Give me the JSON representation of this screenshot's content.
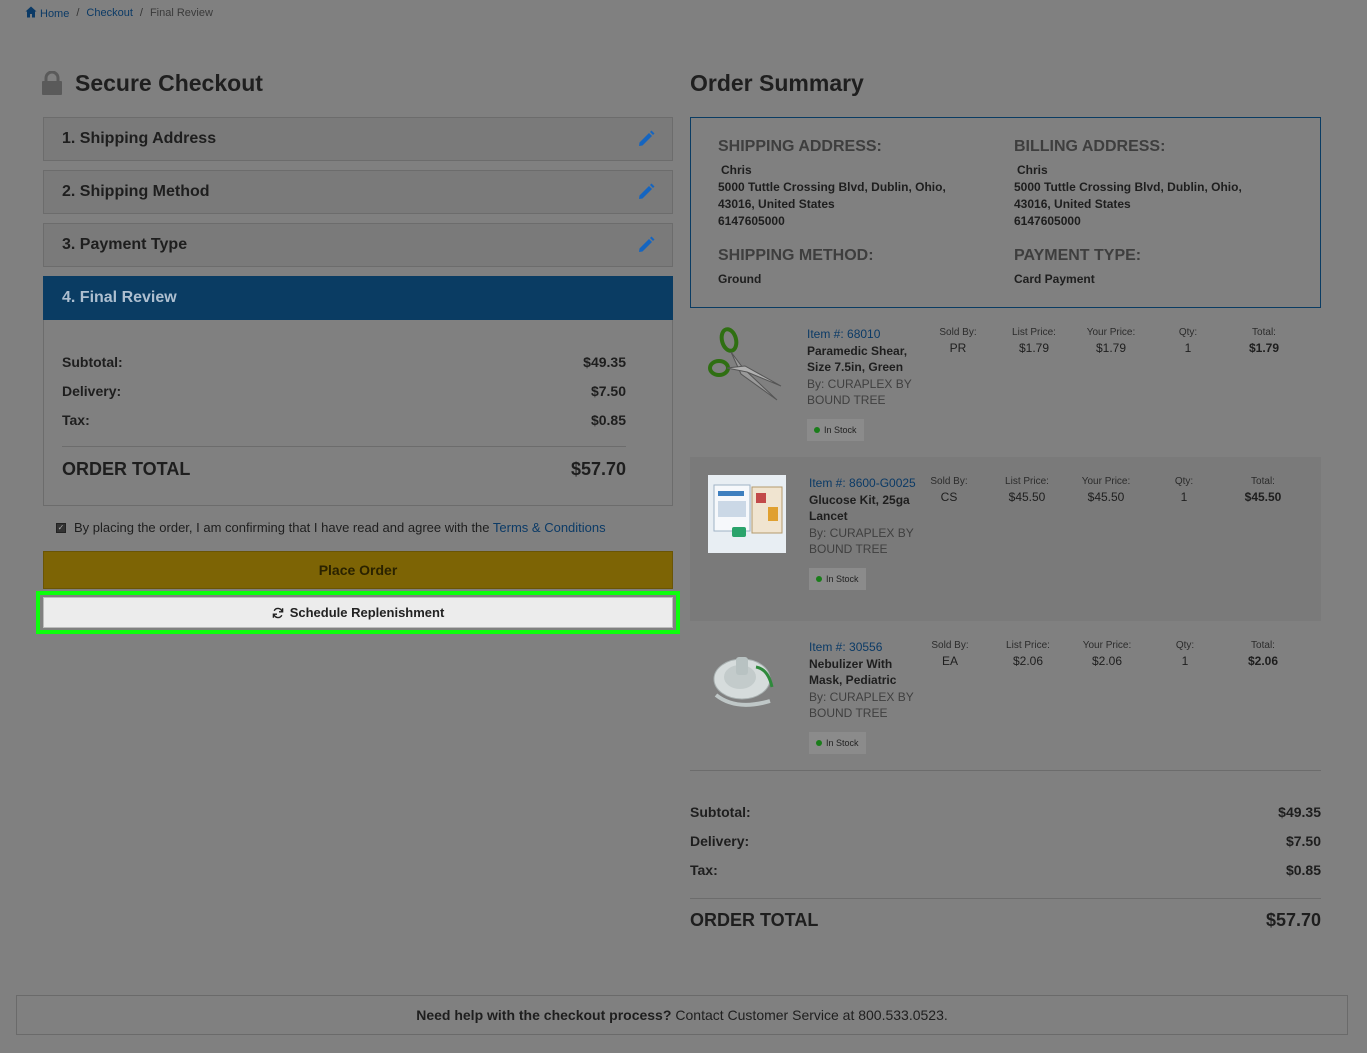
{
  "breadcrumb": {
    "home": "Home",
    "sep1": "/",
    "checkout": "Checkout",
    "sep2": "/",
    "current": "Final Review"
  },
  "checkout": {
    "title": "Secure Checkout",
    "steps": [
      {
        "label": "1. Shipping Address"
      },
      {
        "label": "2. Shipping Method"
      },
      {
        "label": "3. Payment Type"
      },
      {
        "label": "4. Final Review"
      }
    ],
    "totals": {
      "subtotal_label": "Subtotal:",
      "subtotal": "$49.35",
      "delivery_label": "Delivery:",
      "delivery": "$7.50",
      "tax_label": "Tax:",
      "tax": "$0.85",
      "total_label": "ORDER TOTAL",
      "total": "$57.70"
    },
    "agree_text": "By placing the order, I am confirming that I have read and agree with the",
    "terms_link": "Terms & Conditions",
    "place_order": "Place Order",
    "schedule": "Schedule Replenishment"
  },
  "summary": {
    "title": "Order Summary",
    "shipping_heading": "SHIPPING ADDRESS:",
    "shipping": {
      "name": "Chris",
      "line1": "5000 Tuttle Crossing Blvd,  Dublin,  Ohio,",
      "line2": "43016,  United States",
      "phone": "6147605000"
    },
    "billing_heading": "BILLING ADDRESS:",
    "billing": {
      "name": "Chris",
      "line1": "5000 Tuttle Crossing Blvd,  Dublin,  Ohio,",
      "line2": "43016,  United States",
      "phone": "6147605000"
    },
    "method_heading": "SHIPPING METHOD:",
    "method": "Ground",
    "payment_heading": "PAYMENT TYPE:",
    "payment": "Card Payment",
    "headers": {
      "sold_by": "Sold By:",
      "list_price": "List Price:",
      "your_price": "Your Price:",
      "qty": "Qty:",
      "total": "Total:"
    },
    "items": [
      {
        "item_no": "Item #: 68010",
        "name": "Paramedic Shear, Size 7.5in, Green",
        "by": "By: CURAPLEX BY BOUND TREE",
        "stock": "In Stock",
        "sold_by": "PR",
        "list_price": "$1.79",
        "your_price": "$1.79",
        "qty": "1",
        "total": "$1.79"
      },
      {
        "item_no": "Item #: 8600-G0025",
        "name": "Glucose Kit, 25ga Lancet",
        "by": "By: CURAPLEX BY BOUND TREE",
        "stock": "In Stock",
        "sold_by": "CS",
        "list_price": "$45.50",
        "your_price": "$45.50",
        "qty": "1",
        "total": "$45.50"
      },
      {
        "item_no": "Item #: 30556",
        "name": "Nebulizer With Mask, Pediatric",
        "by": "By: CURAPLEX BY BOUND TREE",
        "stock": "In Stock",
        "sold_by": "EA",
        "list_price": "$2.06",
        "your_price": "$2.06",
        "qty": "1",
        "total": "$2.06"
      }
    ],
    "totals": {
      "subtotal_label": "Subtotal:",
      "subtotal": "$49.35",
      "delivery_label": "Delivery:",
      "delivery": "$7.50",
      "tax_label": "Tax:",
      "tax": "$0.85",
      "total_label": "ORDER TOTAL",
      "total": "$57.70"
    }
  },
  "help": {
    "bold": "Need help with the checkout process?",
    "text": "Contact Customer Service at 800.533.0523."
  }
}
